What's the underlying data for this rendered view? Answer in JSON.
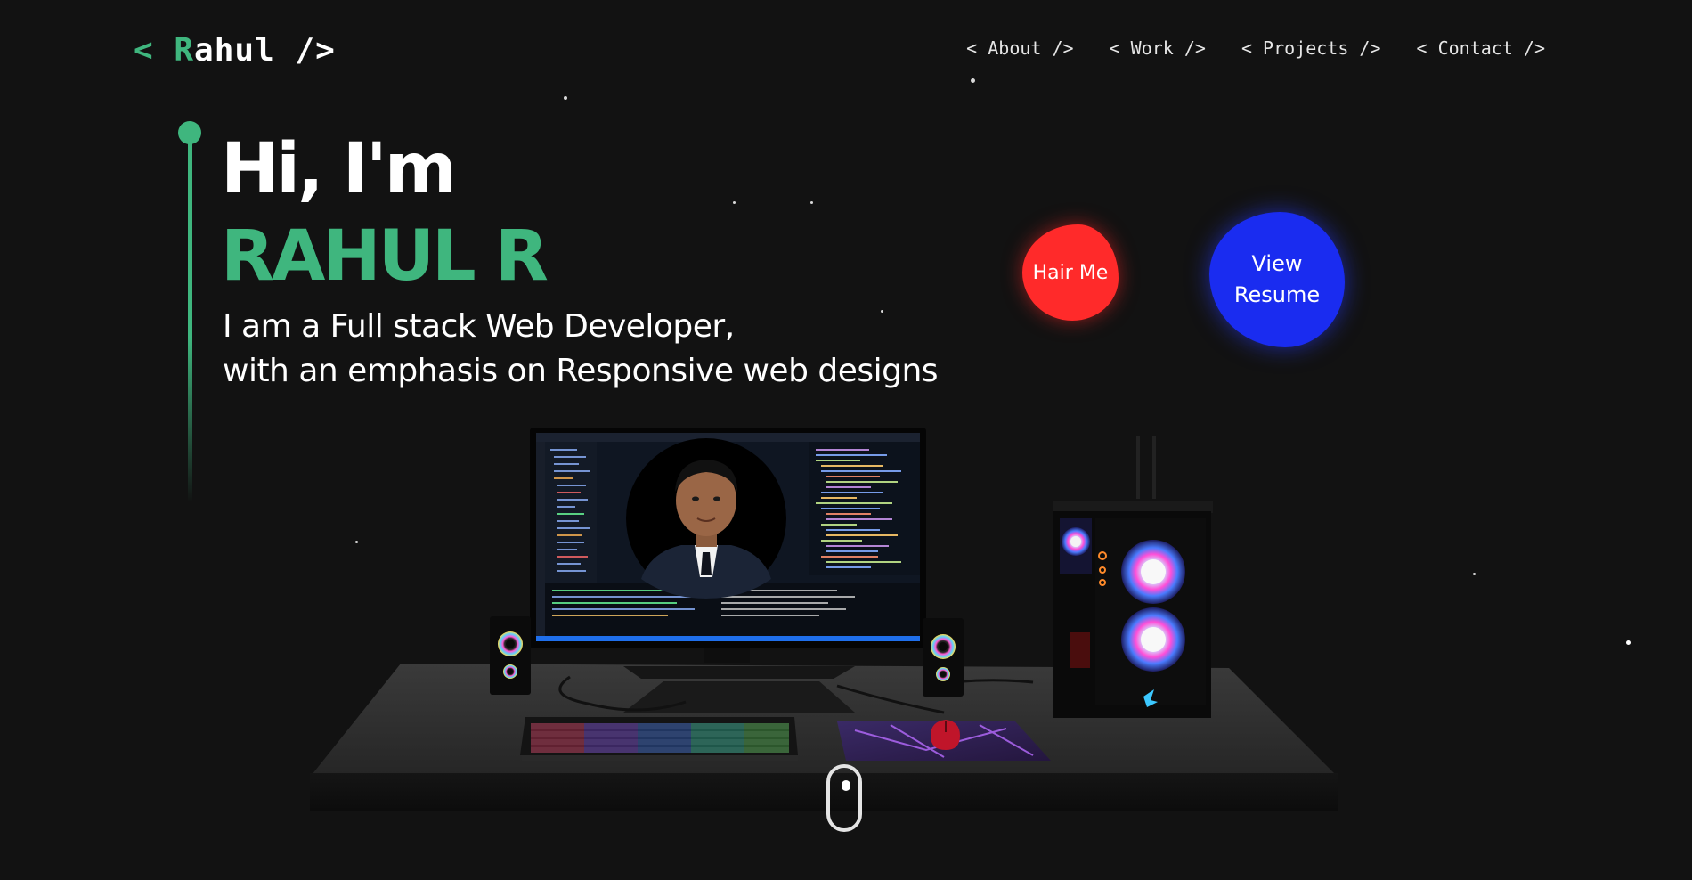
{
  "logo": {
    "bracket_open": "< ",
    "initial": "R",
    "rest": "ahul",
    "bracket_close": " />"
  },
  "nav": {
    "items": [
      {
        "label": "< About />"
      },
      {
        "label": "< Work />"
      },
      {
        "label": "< Projects />"
      },
      {
        "label": "< Contact />"
      }
    ]
  },
  "hero": {
    "greeting": "Hi, I'm",
    "name": "RAHUL R",
    "subtitle_line1": "I am a Full stack Web Developer,",
    "subtitle_line2": "with an emphasis on Responsive web designs"
  },
  "actions": {
    "hire_label": "Hair Me",
    "resume_label_line1": "View",
    "resume_label_line2": "Resume"
  },
  "colors": {
    "background": "#121212",
    "accent_green": "#3fb67e",
    "hire_red": "#ff2a2a",
    "resume_blue": "#1a2cf0"
  },
  "icons": {
    "scroll": "mouse-scroll-icon"
  }
}
